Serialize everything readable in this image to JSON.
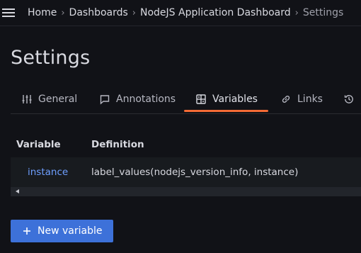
{
  "breadcrumb": {
    "items": [
      "Home",
      "Dashboards",
      "NodeJS Application Dashboard",
      "Settings"
    ],
    "separator": "›"
  },
  "page": {
    "title": "Settings"
  },
  "tabs": [
    {
      "label": "General",
      "icon": "sliders-icon",
      "active": false
    },
    {
      "label": "Annotations",
      "icon": "comment-icon",
      "active": false
    },
    {
      "label": "Variables",
      "icon": "calculator-icon",
      "active": true
    },
    {
      "label": "Links",
      "icon": "link-icon",
      "active": false
    },
    {
      "label": "",
      "icon": "history-icon",
      "active": false
    }
  ],
  "variables_table": {
    "headers": [
      "Variable",
      "Definition"
    ],
    "rows": [
      {
        "variable": "instance",
        "definition": "label_values(nodejs_version_info, instance)"
      }
    ]
  },
  "actions": {
    "new_variable": "New variable"
  },
  "colors": {
    "background": "#111217",
    "accent": "#f46a35",
    "link": "#6e9fff",
    "primary_button": "#3d71d9"
  }
}
